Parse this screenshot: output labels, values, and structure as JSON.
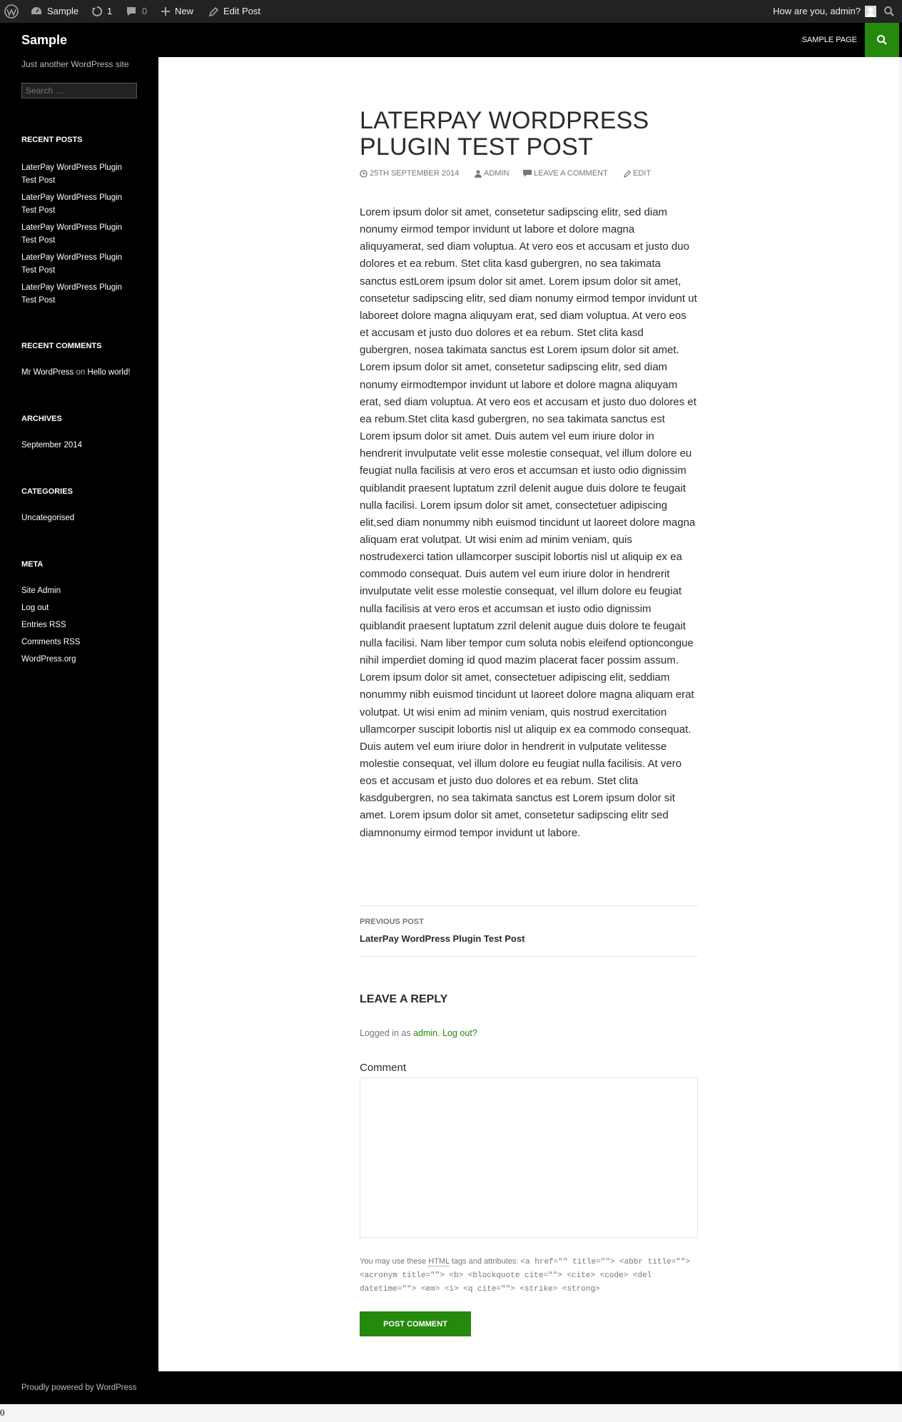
{
  "adminbar": {
    "site_name": "Sample",
    "updates_count": "1",
    "comments_count": "0",
    "new_label": "New",
    "edit_post_label": "Edit Post",
    "greeting": "How are you, admin?"
  },
  "header": {
    "site_title": "Sample",
    "menu_item": "Sample Page"
  },
  "sidebar": {
    "tagline": "Just another WordPress site",
    "search_placeholder": "Search …",
    "recent_posts_title": "Recent Posts",
    "recent_posts": [
      "LaterPay WordPress Plugin Test Post",
      "LaterPay WordPress Plugin Test Post",
      "LaterPay WordPress Plugin Test Post",
      "LaterPay WordPress Plugin Test Post",
      "LaterPay WordPress Plugin Test Post"
    ],
    "recent_comments_title": "Recent Comments",
    "recent_comment_author": "Mr WordPress",
    "recent_comment_on": "on",
    "recent_comment_post": "Hello world!",
    "archives_title": "Archives",
    "archive_item": "September 2014",
    "categories_title": "Categories",
    "category_item": "Uncategorised",
    "meta_title": "Meta",
    "meta_items": [
      "Site Admin",
      "Log out",
      "Entries RSS",
      "Comments RSS",
      "WordPress.org"
    ]
  },
  "post": {
    "title": "LaterPay WordPress Plugin Test Post",
    "date": "25th September 2014",
    "author": "admin",
    "comment_link": "Leave a comment",
    "edit_link": "Edit",
    "body": "Lorem ipsum dolor sit amet, consetetur sadipscing elitr, sed diam nonumy eirmod tempor invidunt ut labore et dolore magna aliquyamerat, sed diam voluptua. At vero eos et accusam et justo duo dolores et ea rebum. Stet clita kasd gubergren, no sea takimata sanctus estLorem ipsum dolor sit amet. Lorem ipsum dolor sit amet, consetetur sadipscing elitr, sed diam nonumy eirmod tempor invidunt ut laboreet dolore magna aliquyam erat, sed diam voluptua. At vero eos et accusam et justo duo dolores et ea rebum. Stet clita kasd gubergren, nosea takimata sanctus est Lorem ipsum dolor sit amet. Lorem ipsum dolor sit amet, consetetur sadipscing elitr, sed diam nonumy eirmodtempor invidunt ut labore et dolore magna aliquyam erat, sed diam voluptua. At vero eos et accusam et justo duo dolores et ea rebum.Stet clita kasd gubergren, no sea takimata sanctus est Lorem ipsum dolor sit amet. Duis autem vel eum iriure dolor in hendrerit invulputate velit esse molestie consequat, vel illum dolore eu feugiat nulla facilisis at vero eros et accumsan et iusto odio dignissim quiblandit praesent luptatum zzril delenit augue duis dolore te feugait nulla facilisi. Lorem ipsum dolor sit amet, consectetuer adipiscing elit,sed diam nonummy nibh euismod tincidunt ut laoreet dolore magna aliquam erat volutpat. Ut wisi enim ad minim veniam, quis nostrudexerci tation ullamcorper suscipit lobortis nisl ut aliquip ex ea commodo consequat. Duis autem vel eum iriure dolor in hendrerit invulputate velit esse molestie consequat, vel illum dolore eu feugiat nulla facilisis at vero eros et accumsan et iusto odio dignissim quiblandit praesent luptatum zzril delenit augue duis dolore te feugait nulla facilisi. Nam liber tempor cum soluta nobis eleifend optioncongue nihil imperdiet doming id quod mazim placerat facer possim assum. Lorem ipsum dolor sit amet, consectetuer adipiscing elit, seddiam nonummy nibh euismod tincidunt ut laoreet dolore magna aliquam erat volutpat. Ut wisi enim ad minim veniam, quis nostrud exercitation ullamcorper suscipit lobortis nisl ut aliquip ex ea commodo consequat. Duis autem vel eum iriure dolor in hendrerit in vulputate velitesse molestie consequat, vel illum dolore eu feugiat nulla facilisis. At vero eos et accusam et justo duo dolores et ea rebum. Stet clita kasdgubergren, no sea takimata sanctus est Lorem ipsum dolor sit amet. Lorem ipsum dolor sit amet, consetetur sadipscing elitr sed diamnonumy eirmod tempor invidunt ut labore."
  },
  "navigation": {
    "prev_label": "Previous Post",
    "prev_title": "LaterPay WordPress Plugin Test Post"
  },
  "reply": {
    "title": "Leave a Reply",
    "logged_in_prefix": "Logged in as",
    "username": "admin",
    "logout": "Log out?",
    "comment_label": "Comment",
    "allowed_prefix": "You may use these",
    "allowed_abbr": "HTML",
    "allowed_mid": "tags and attributes:",
    "allowed_tags": "<a href=\"\" title=\"\"> <abbr title=\"\"> <acronym title=\"\"> <b> <blockquote cite=\"\"> <cite> <code> <del datetime=\"\"> <em> <i> <q cite=\"\"> <strike> <strong>",
    "submit_label": "Post Comment"
  },
  "footer": {
    "text": "Proudly powered by WordPress"
  },
  "stray_text": "0",
  "colors": {
    "accent": "#24890d",
    "adminbar_bg": "#222222",
    "sidebar_bg": "#000000"
  }
}
